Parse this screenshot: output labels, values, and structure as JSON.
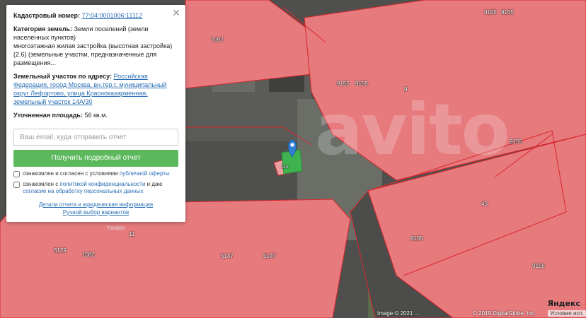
{
  "popup": {
    "cadastral_label": "Кадастровый номер:",
    "cadastral_number": "77:04:0001006:11112",
    "category_label": "Категория земель:",
    "category_value": "Земли поселений (земли населенных пунктов)",
    "category_desc": "многоэтажная жилая застройка (высотная застройка) (2.6) (земельные участки, предназначенные для размещения...",
    "address_label": "Земельный участок по адресу:",
    "address_value": "Российская Федерация, город Москва, вн.тер.г. муниципальный округ Лефортово, улица Красноказарменная, земельный участок 14А/30",
    "area_label": "Уточненная площадь:",
    "area_value": "56 кв.м.",
    "email_placeholder": "Ваш email, куда отправить отчет",
    "report_button": "Получить подробный отчет",
    "consent1_prefix": "ознакомлен и согласен с условиями ",
    "consent1_link": "публичной оферты",
    "consent2_prefix": "ознакомлен с ",
    "consent2_link1": "политикой конфиденциальности",
    "consent2_mid": " и даю ",
    "consent2_link2": "согласие на обработку персональных данных",
    "details_link": "Детали отчета и юридическая информация",
    "manual_link": "Ручной выбор вариантов",
    "close_symbol": "✕"
  },
  "map": {
    "plot_labels": [
      "9155",
      "9155",
      "7097",
      "9155",
      "9155",
      "9",
      "9155",
      "43",
      "9155",
      "9155",
      "5129",
      "1082",
      "5147",
      "5147",
      "11"
    ],
    "watermark": "avito",
    "yandex_small": "Yandex",
    "copyright_image": "Image © 2021 ...",
    "copyright_digital": "© 2019 DigitalGlobe, Inc.",
    "terms": "Условия исп.",
    "logo": "Яндекс",
    "marker_plot_label": "14А"
  },
  "colors": {
    "plot_fill": "#e67a7d",
    "plot_stroke": "#d9262c",
    "button_green": "#5cb85c",
    "link_blue": "#2a6fb5",
    "marker_blue": "#2f7fd3"
  }
}
